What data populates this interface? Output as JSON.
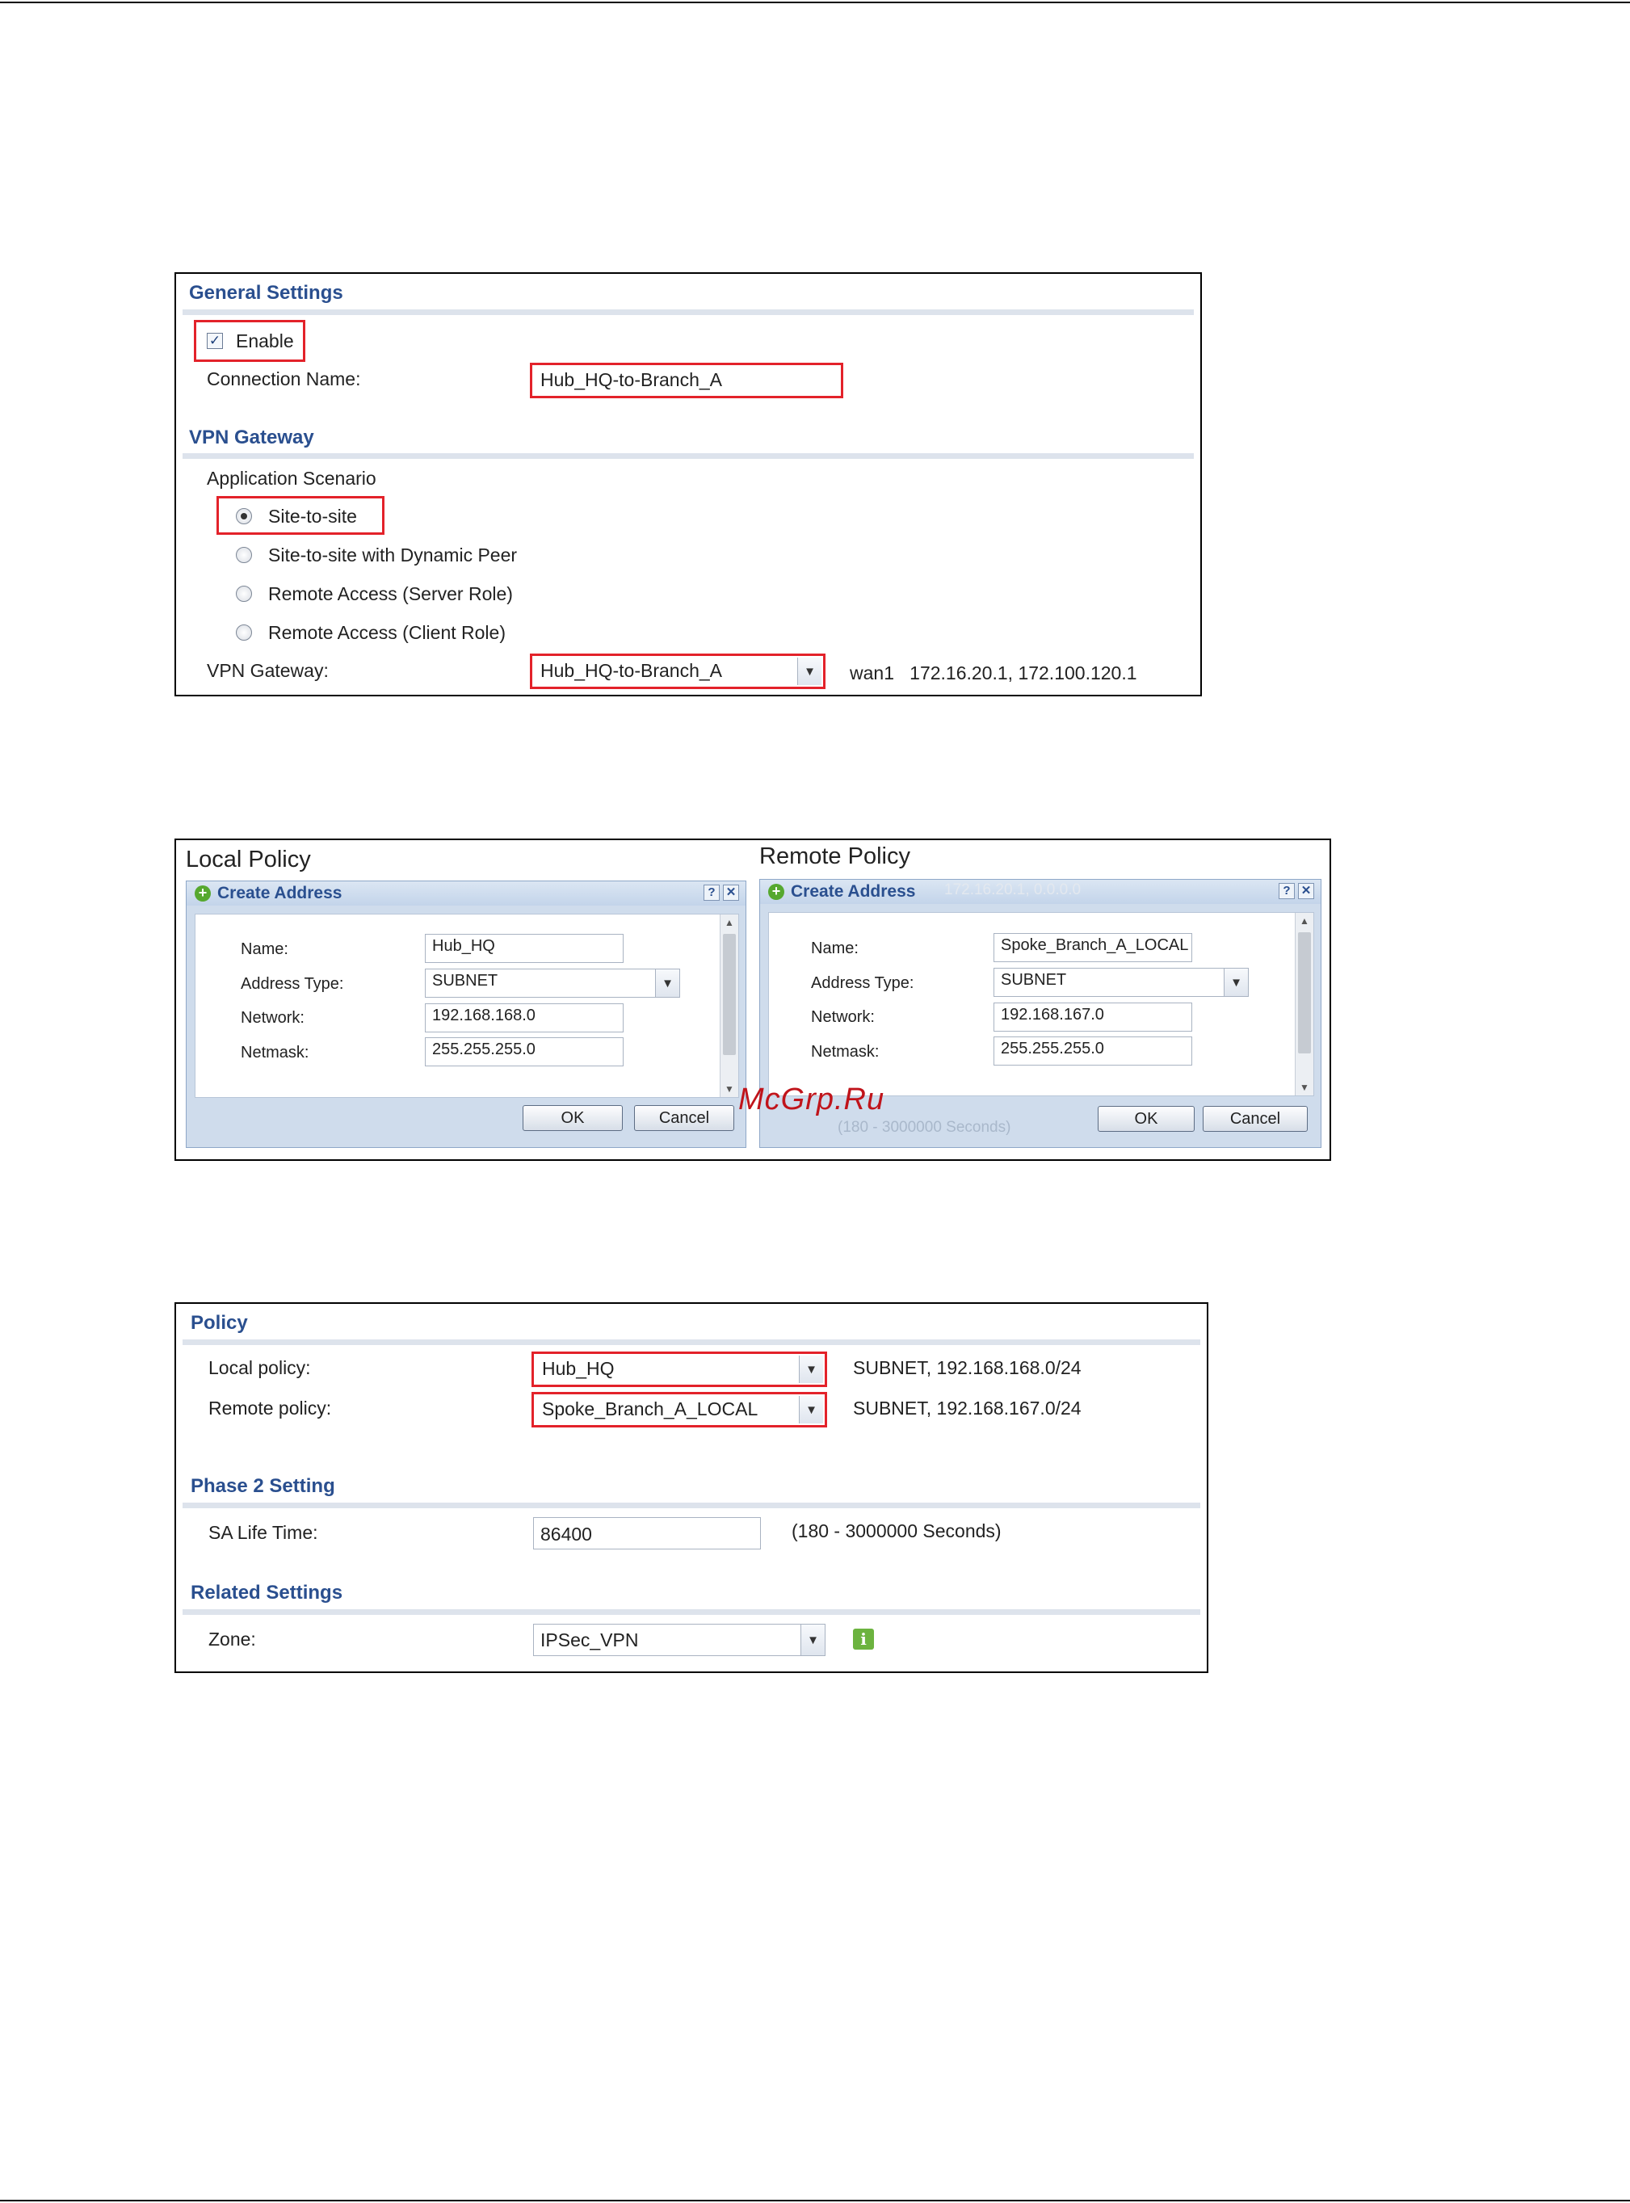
{
  "general": {
    "section_title": "General Settings",
    "enable_label": "Enable",
    "connection_name_label": "Connection Name:",
    "connection_name_value": "Hub_HQ-to-Branch_A"
  },
  "vpn_gateway": {
    "section_title": "VPN Gateway",
    "scenario_label": "Application Scenario",
    "options": [
      "Site-to-site",
      "Site-to-site with Dynamic Peer",
      "Remote Access (Server Role)",
      "Remote Access (Client Role)"
    ],
    "gateway_label": "VPN Gateway:",
    "gateway_value": "Hub_HQ-to-Branch_A",
    "gateway_info": "wan1   172.16.20.1, 172.100.120.1"
  },
  "local_policy": {
    "caption": "Local Policy",
    "dialog_title": "Create Address",
    "name_label": "Name:",
    "name_value": "Hub_HQ",
    "type_label": "Address Type:",
    "type_value": "SUBNET",
    "network_label": "Network:",
    "network_value": "192.168.168.0",
    "netmask_label": "Netmask:",
    "netmask_value": "255.255.255.0",
    "ok_label": "OK",
    "cancel_label": "Cancel"
  },
  "remote_policy": {
    "caption": "Remote Policy",
    "dialog_title": "Create Address",
    "name_label": "Name:",
    "name_value": "Spoke_Branch_A_LOCAL",
    "type_label": "Address Type:",
    "type_value": "SUBNET",
    "network_label": "Network:",
    "network_value": "192.168.167.0",
    "netmask_label": "Netmask:",
    "netmask_value": "255.255.255.0",
    "ok_label": "OK",
    "cancel_label": "Cancel",
    "ghost_text_top": "172.16.20.1, 0.0.0.0",
    "ghost_text_bottom": "(180 - 3000000 Seconds)"
  },
  "watermark": "McGrp.Ru",
  "policy": {
    "section_title": "Policy",
    "local_label": "Local policy:",
    "local_value": "Hub_HQ",
    "local_info": "SUBNET, 192.168.168.0/24",
    "remote_label": "Remote policy:",
    "remote_value": "Spoke_Branch_A_LOCAL",
    "remote_info": "SUBNET, 192.168.167.0/24"
  },
  "phase2": {
    "section_title": "Phase 2 Setting",
    "sa_label": "SA Life Time:",
    "sa_value": "86400",
    "sa_hint": "(180 - 3000000 Seconds)"
  },
  "related": {
    "section_title": "Related Settings",
    "zone_label": "Zone:",
    "zone_value": "IPSec_VPN"
  },
  "colors": {
    "highlight": "#e3222a",
    "section_title": "#2a4f8f"
  }
}
